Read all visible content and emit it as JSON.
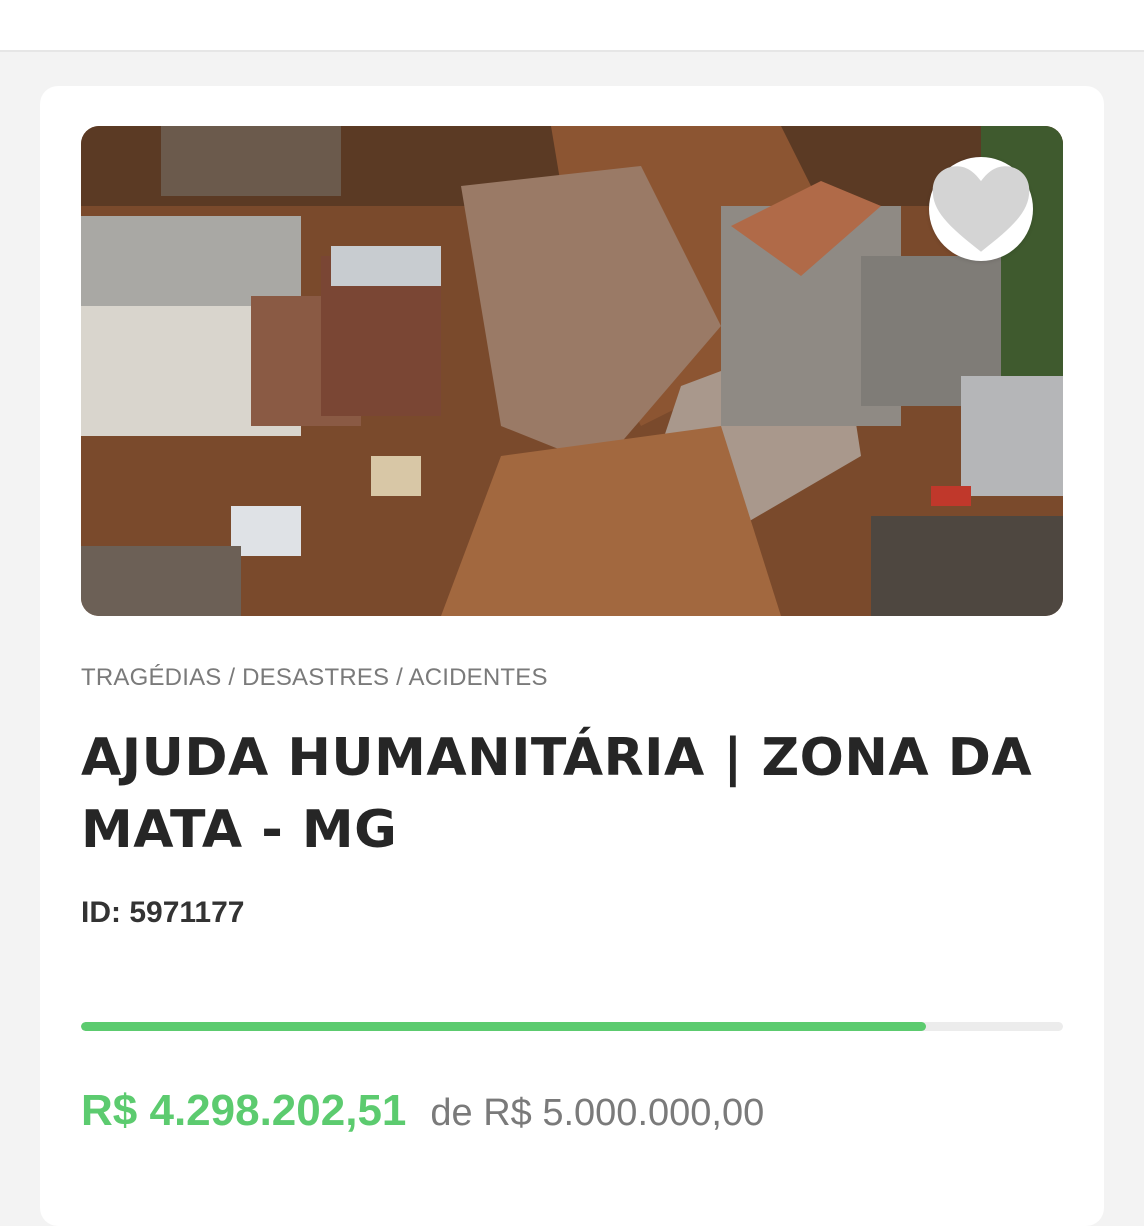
{
  "campaign": {
    "image_alt": "Aerial view of landslide destruction",
    "favorite_icon": "heart-icon",
    "category": "TRAGÉDIAS / DESASTRES / ACIDENTES",
    "title": "AJUDA HUMANITÁRIA | ZONA DA MATA - MG",
    "id_text": "ID: 5971177",
    "progress_fraction": 0.86,
    "raised_text": "R$ 4.298.202,51",
    "goal_text": "de R$ 5.000.000,00"
  },
  "colors": {
    "accent": "#5ccb6f",
    "title": "#262626",
    "muted": "#7a7a7a",
    "track": "#ececec"
  }
}
